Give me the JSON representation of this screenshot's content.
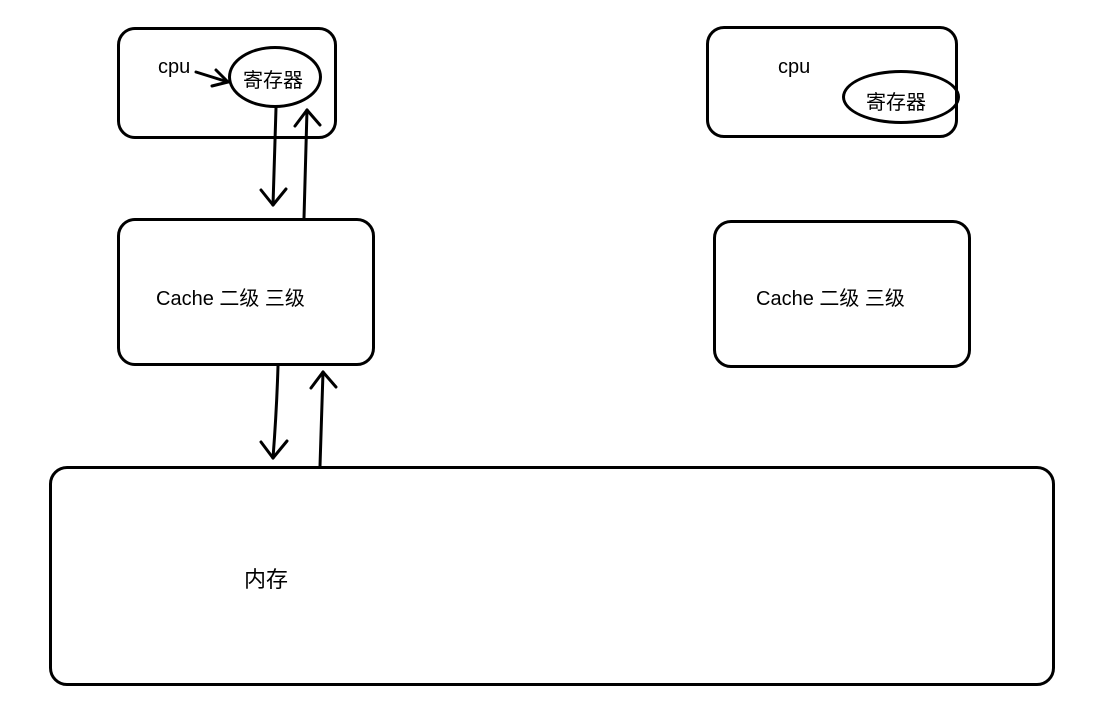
{
  "left": {
    "cpu_label": "cpu",
    "register_label": "寄存器",
    "cache_label": "Cache 二级 三级"
  },
  "right": {
    "cpu_label": "cpu",
    "register_label": "寄存器",
    "cache_label": "Cache 二级 三级"
  },
  "memory_label": "内存"
}
